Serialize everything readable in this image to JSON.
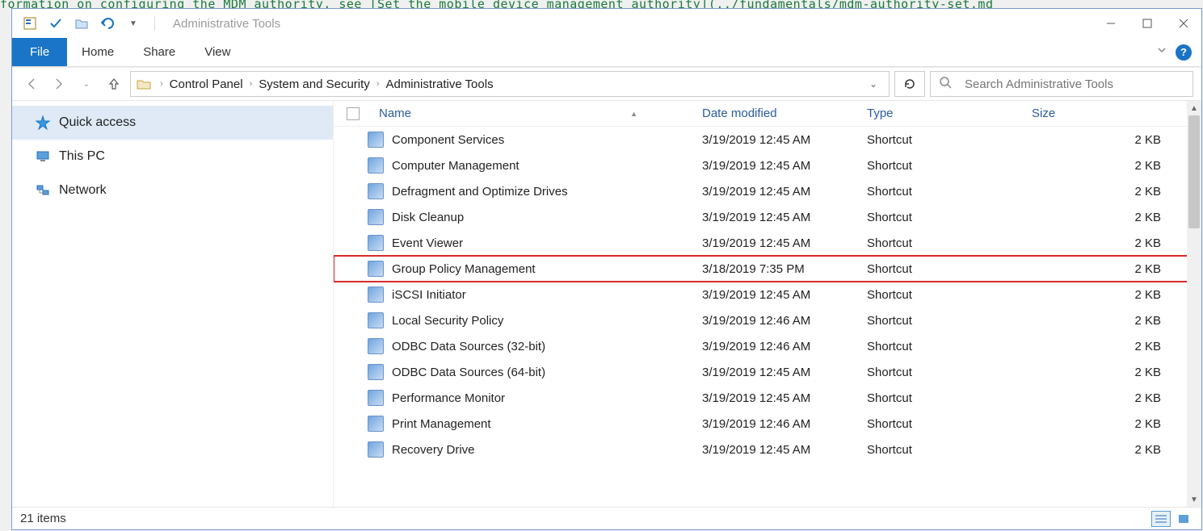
{
  "window_title": "Administrative Tools",
  "ribbon_tabs": {
    "file": "File",
    "home": "Home",
    "share": "Share",
    "view": "View"
  },
  "breadcrumb": {
    "seg0": "Control Panel",
    "seg1": "System and Security",
    "seg2": "Administrative Tools"
  },
  "search": {
    "placeholder": "Search Administrative Tools"
  },
  "sidebar": {
    "items": [
      {
        "label": "Quick access"
      },
      {
        "label": "This PC"
      },
      {
        "label": "Network"
      }
    ]
  },
  "columns": {
    "name": "Name",
    "date": "Date modified",
    "type": "Type",
    "size": "Size"
  },
  "files": [
    {
      "name": "Component Services",
      "date": "3/19/2019 12:45 AM",
      "type": "Shortcut",
      "size": "2 KB",
      "hl": false
    },
    {
      "name": "Computer Management",
      "date": "3/19/2019 12:45 AM",
      "type": "Shortcut",
      "size": "2 KB",
      "hl": false
    },
    {
      "name": "Defragment and Optimize Drives",
      "date": "3/19/2019 12:45 AM",
      "type": "Shortcut",
      "size": "2 KB",
      "hl": false
    },
    {
      "name": "Disk Cleanup",
      "date": "3/19/2019 12:45 AM",
      "type": "Shortcut",
      "size": "2 KB",
      "hl": false
    },
    {
      "name": "Event Viewer",
      "date": "3/19/2019 12:45 AM",
      "type": "Shortcut",
      "size": "2 KB",
      "hl": false
    },
    {
      "name": "Group Policy Management",
      "date": "3/18/2019 7:35 PM",
      "type": "Shortcut",
      "size": "2 KB",
      "hl": true
    },
    {
      "name": "iSCSI Initiator",
      "date": "3/19/2019 12:45 AM",
      "type": "Shortcut",
      "size": "2 KB",
      "hl": false
    },
    {
      "name": "Local Security Policy",
      "date": "3/19/2019 12:46 AM",
      "type": "Shortcut",
      "size": "2 KB",
      "hl": false
    },
    {
      "name": "ODBC Data Sources (32-bit)",
      "date": "3/19/2019 12:46 AM",
      "type": "Shortcut",
      "size": "2 KB",
      "hl": false
    },
    {
      "name": "ODBC Data Sources (64-bit)",
      "date": "3/19/2019 12:45 AM",
      "type": "Shortcut",
      "size": "2 KB",
      "hl": false
    },
    {
      "name": "Performance Monitor",
      "date": "3/19/2019 12:45 AM",
      "type": "Shortcut",
      "size": "2 KB",
      "hl": false
    },
    {
      "name": "Print Management",
      "date": "3/19/2019 12:46 AM",
      "type": "Shortcut",
      "size": "2 KB",
      "hl": false
    },
    {
      "name": "Recovery Drive",
      "date": "3/19/2019 12:45 AM",
      "type": "Shortcut",
      "size": "2 KB",
      "hl": false
    }
  ],
  "status": {
    "count": "21 items"
  },
  "bg_text": "formation on configuring the MDM authority, see [Set the mobile device management authority](../fundamentals/mdm-authority-set.md"
}
